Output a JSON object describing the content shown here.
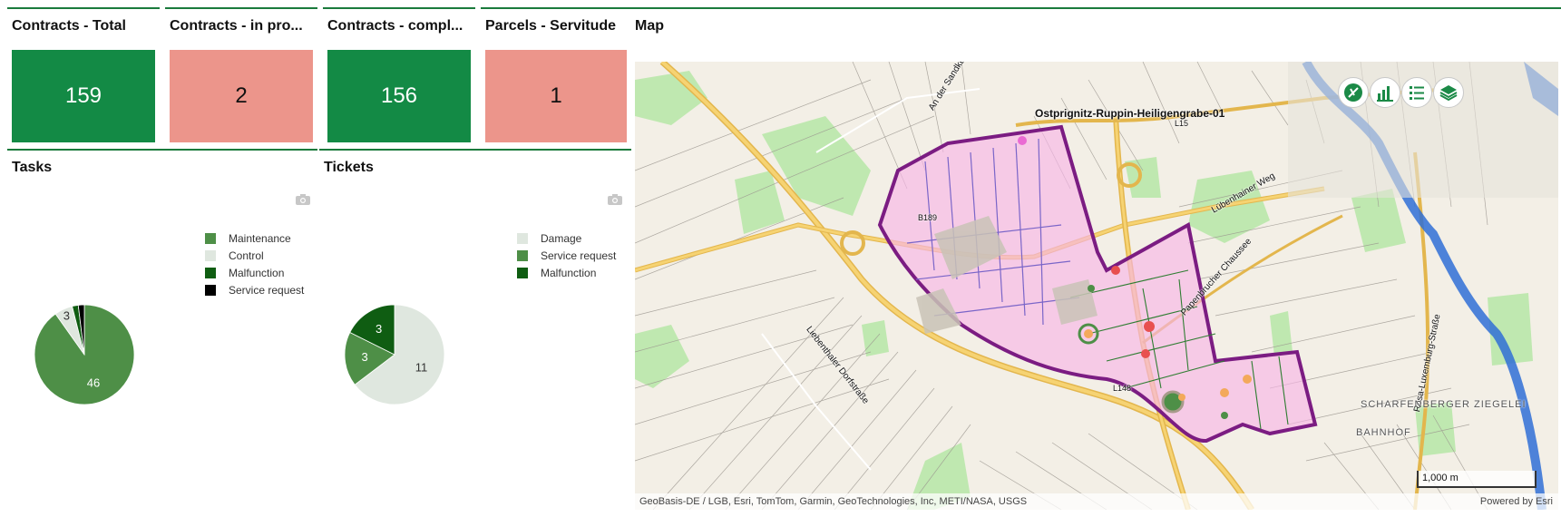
{
  "kpis": [
    {
      "title": "Contracts - Total",
      "value": "159",
      "color": "#138a45"
    },
    {
      "title": "Contracts - in pro...",
      "value": "2",
      "color": "#ec958b"
    },
    {
      "title": "Contracts - compl...",
      "value": "156",
      "color": "#138a45"
    },
    {
      "title": "Parcels - Servitude",
      "value": "1",
      "color": "#ec958b"
    }
  ],
  "tasks": {
    "title": "Tasks",
    "icon": "camera-icon",
    "chart_data": {
      "type": "pie",
      "categories": [
        "Maintenance",
        "Control",
        "Malfunction",
        "Service request"
      ],
      "values": [
        46,
        3,
        1,
        1
      ],
      "colors": [
        "#4e8f47",
        "#dfe7df",
        "#0f5d12",
        "#000000"
      ],
      "data_labels": [
        "46",
        "3",
        "",
        ""
      ]
    }
  },
  "tickets": {
    "title": "Tickets",
    "icon": "camera-icon",
    "chart_data": {
      "type": "pie",
      "categories": [
        "Damage",
        "Service request",
        "Malfunction"
      ],
      "values": [
        11,
        3,
        3
      ],
      "colors": [
        "#dfe7df",
        "#4e8f47",
        "#0f5d12"
      ],
      "data_labels": [
        "11",
        "3",
        "3"
      ]
    }
  },
  "map": {
    "title": "Map",
    "area_label": "Ostprignitz-Ruppin-Heiligengrabe-01",
    "road_labels": [
      "L15",
      "B189",
      "L148"
    ],
    "street_labels": [
      "An der Sandkuhle",
      "Lübenhainer Weg",
      "Papenbrucher Chaussee",
      "Rosa-Luxemburg-Straße",
      "Liebenthaler Dorfstraße"
    ],
    "place_labels": [
      "SCHARFENBERGER ZIEGELEI",
      "BAHNHOF"
    ],
    "scale_label": "1,000 m",
    "attribution": "GeoBasis-DE / LGB, Esri, TomTom, Garmin, GeoTechnologies, Inc, METI/NASA, USGS",
    "powered_by": "Powered by Esri",
    "buttons": [
      "clear-selection-icon",
      "bar-chart-icon",
      "legend-list-icon",
      "layers-icon"
    ]
  }
}
